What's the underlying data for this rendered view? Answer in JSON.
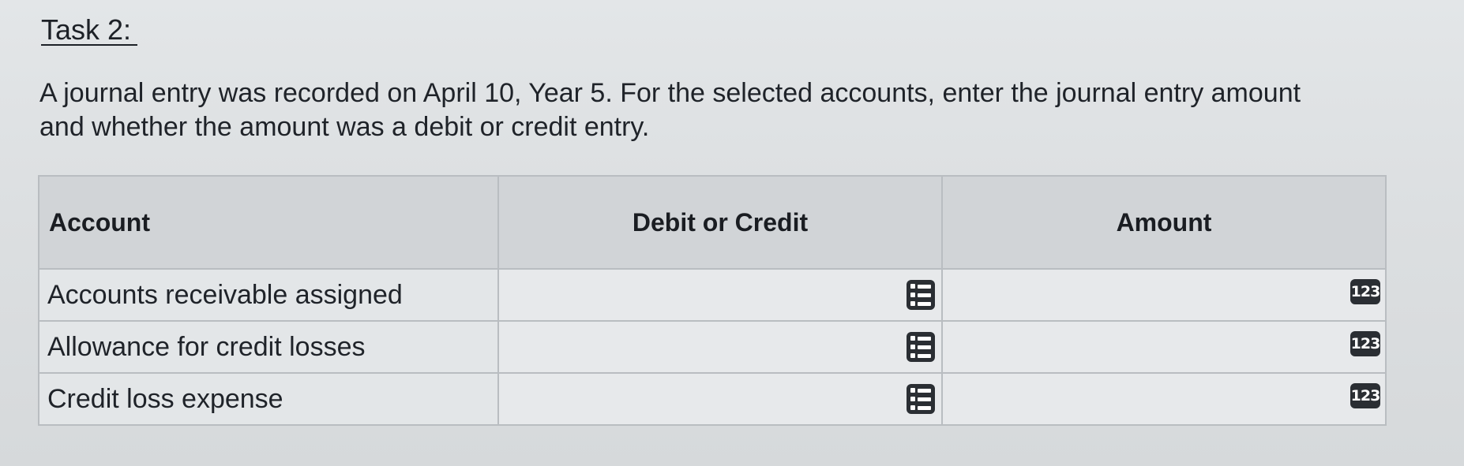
{
  "task": {
    "title": "Task 2:",
    "instructions": "A journal entry was recorded on April 10, Year 5. For the selected accounts, enter the journal entry amount and whether the amount was a debit or credit entry."
  },
  "table": {
    "headers": {
      "account": "Account",
      "debit_credit": "Debit or Credit",
      "amount": "Amount"
    },
    "rows": [
      {
        "account": "Accounts receivable assigned",
        "debit_credit": "",
        "amount": ""
      },
      {
        "account": "Allowance for credit losses",
        "debit_credit": "",
        "amount": ""
      },
      {
        "account": "Credit loss expense",
        "debit_credit": "",
        "amount": ""
      }
    ]
  },
  "icons": {
    "selector": "list-select-icon",
    "numeric": "numeric-input-icon",
    "numeric_label": "123"
  }
}
